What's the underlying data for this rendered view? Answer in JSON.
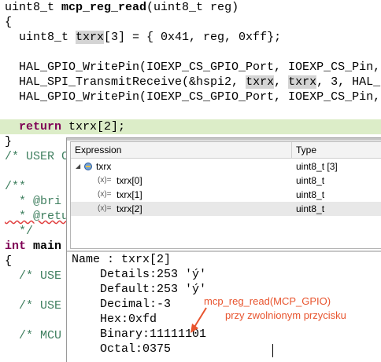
{
  "editor": {
    "lines": [
      {
        "t1": "uint8_t ",
        "t2": "mcp_reg_read",
        "t3": "(uint8_t reg)"
      },
      {
        "text": "{"
      },
      {
        "t1": "  uint8_t ",
        "t2": "txrx",
        "t3": "[3] = { 0x41, reg, 0xff};"
      },
      {
        "text": ""
      },
      {
        "text": "  HAL_GPIO_WritePin(IOEXP_CS_GPIO_Port, IOEXP_CS_Pin, "
      },
      {
        "t1": "  HAL_SPI_TransmitReceive(&hspi2, ",
        "t2": "txrx",
        "t3": ", ",
        "t4": "txrx",
        "t5": ", 3, HAL_"
      },
      {
        "text": "  HAL_GPIO_WritePin(IOEXP_CS_GPIO_Port, IOEXP_CS_Pin, "
      },
      {
        "text": ""
      },
      {
        "t1": "  return",
        "t2": " txrx[2];"
      },
      {
        "text": "}"
      },
      {
        "text": "/* USER C"
      },
      {
        "text": ""
      },
      {
        "text": "/**"
      },
      {
        "text": "  * @bri"
      },
      {
        "text": "  * @retu"
      },
      {
        "text": "  */"
      },
      {
        "t1": "int",
        "t2": " main"
      },
      {
        "text": "{"
      },
      {
        "text": "  /* USE"
      },
      {
        "text": ""
      },
      {
        "text": "  /* USE"
      },
      {
        "text": ""
      },
      {
        "text": "  /* MCU"
      }
    ]
  },
  "popup": {
    "columns": {
      "expression": "Expression",
      "type": "Type"
    },
    "rows": [
      {
        "expand": "◢",
        "name": "txrx",
        "type": "uint8_t [3]"
      },
      {
        "prefix": "(x)=",
        "name": "txrx[0]",
        "type": "uint8_t"
      },
      {
        "prefix": "(x)=",
        "name": "txrx[1]",
        "type": "uint8_t"
      },
      {
        "prefix": "(x)=",
        "name": "txrx[2]",
        "type": "uint8_t"
      }
    ],
    "details": {
      "name": "Name : txrx[2]",
      "lines": [
        "Details:253 'ý'",
        "Default:253 'ý'",
        "Decimal:-3",
        "Hex:0xfd",
        "Binary:11111101",
        "Octal:0375"
      ]
    }
  },
  "annotation": {
    "line1": "mcp_reg_read(MCP_GPIO)",
    "line2": "przy zwolnionym przycisku",
    "color": "#e8542e"
  }
}
